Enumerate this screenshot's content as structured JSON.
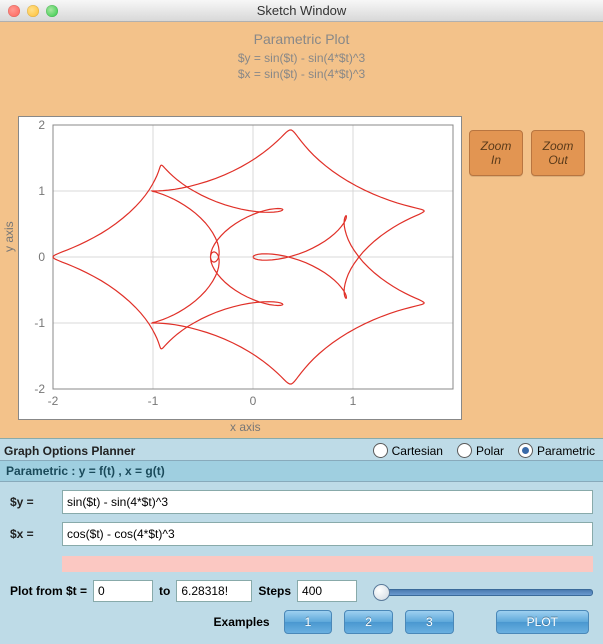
{
  "window": {
    "title": "Sketch Window"
  },
  "plot": {
    "title": "Parametric Plot",
    "eq_y_display": "$y = sin($t) - sin(4*$t)^3",
    "eq_x_display": "$x = sin($t) - sin(4*$t)^3",
    "xlabel": "x axis",
    "ylabel": "y axis",
    "zoom_in": "Zoom\nIn",
    "zoom_out": "Zoom\nOut"
  },
  "chart_data": {
    "type": "line",
    "parametric": true,
    "x_expr": "cos(t) - cos(4*t)^3",
    "y_expr": "sin(t) - sin(4*t)^3",
    "t_start": 0,
    "t_end": 6.28318530718,
    "steps": 400,
    "xlim": [
      -2,
      2
    ],
    "ylim": [
      -2,
      2
    ],
    "xticks": [
      -2,
      -1,
      0,
      1
    ],
    "yticks": [
      -2,
      -1,
      0,
      1,
      2
    ],
    "title": "Parametric Plot",
    "xlabel": "x axis",
    "ylabel": "y axis"
  },
  "planner": {
    "header": "Graph Options Planner",
    "modes": {
      "cartesian": "Cartesian",
      "polar": "Polar",
      "parametric": "Parametric",
      "selected": "parametric"
    },
    "strip": "Parametric : y = f(t) ,  x = g(t)",
    "y_label": "$y =",
    "x_label": "$x =",
    "y_input": "sin($t) - sin(4*$t)^3",
    "x_input": "cos($t) - cos(4*$t)^3",
    "plot_from": "Plot from $t =",
    "t_start": "0",
    "to": "to",
    "t_end": "6.28318!",
    "steps_label": "Steps",
    "steps": "400",
    "examples": "Examples",
    "ex1": "1",
    "ex2": "2",
    "ex3": "3",
    "plot_btn": "PLOT"
  }
}
